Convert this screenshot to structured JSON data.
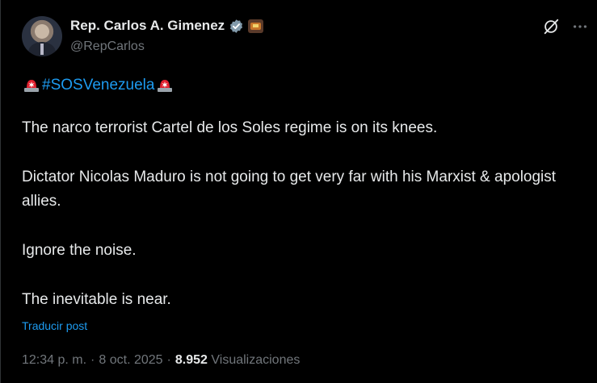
{
  "author": {
    "name": "Rep. Carlos A. Gimenez",
    "handle": "@RepCarlos"
  },
  "post": {
    "hashtag": "#SOSVenezuela",
    "paragraphs": [
      "The narco terrorist Cartel de los Soles regime is on its knees.",
      "Dictator Nicolas Maduro is not going to get very far with his Marxist & apologist allies.",
      "Ignore the noise.",
      "The inevitable is near."
    ],
    "translate_label": "Traducir post"
  },
  "meta": {
    "time": "12:34 p. m.",
    "date": "8 oct. 2025",
    "separator": "·",
    "views_count": "8.952",
    "views_label": "Visualizaciones"
  },
  "icons": {
    "verified": "verified-badge-icon",
    "affiliate": "affiliate-badge-icon",
    "grok": "grok-icon",
    "more": "more-icon",
    "siren": "police-siren-icon"
  },
  "colors": {
    "background": "#000000",
    "text": "#e7e9ea",
    "secondary": "#71767b",
    "accent": "#1d9bf0",
    "siren": "#e0202e"
  }
}
